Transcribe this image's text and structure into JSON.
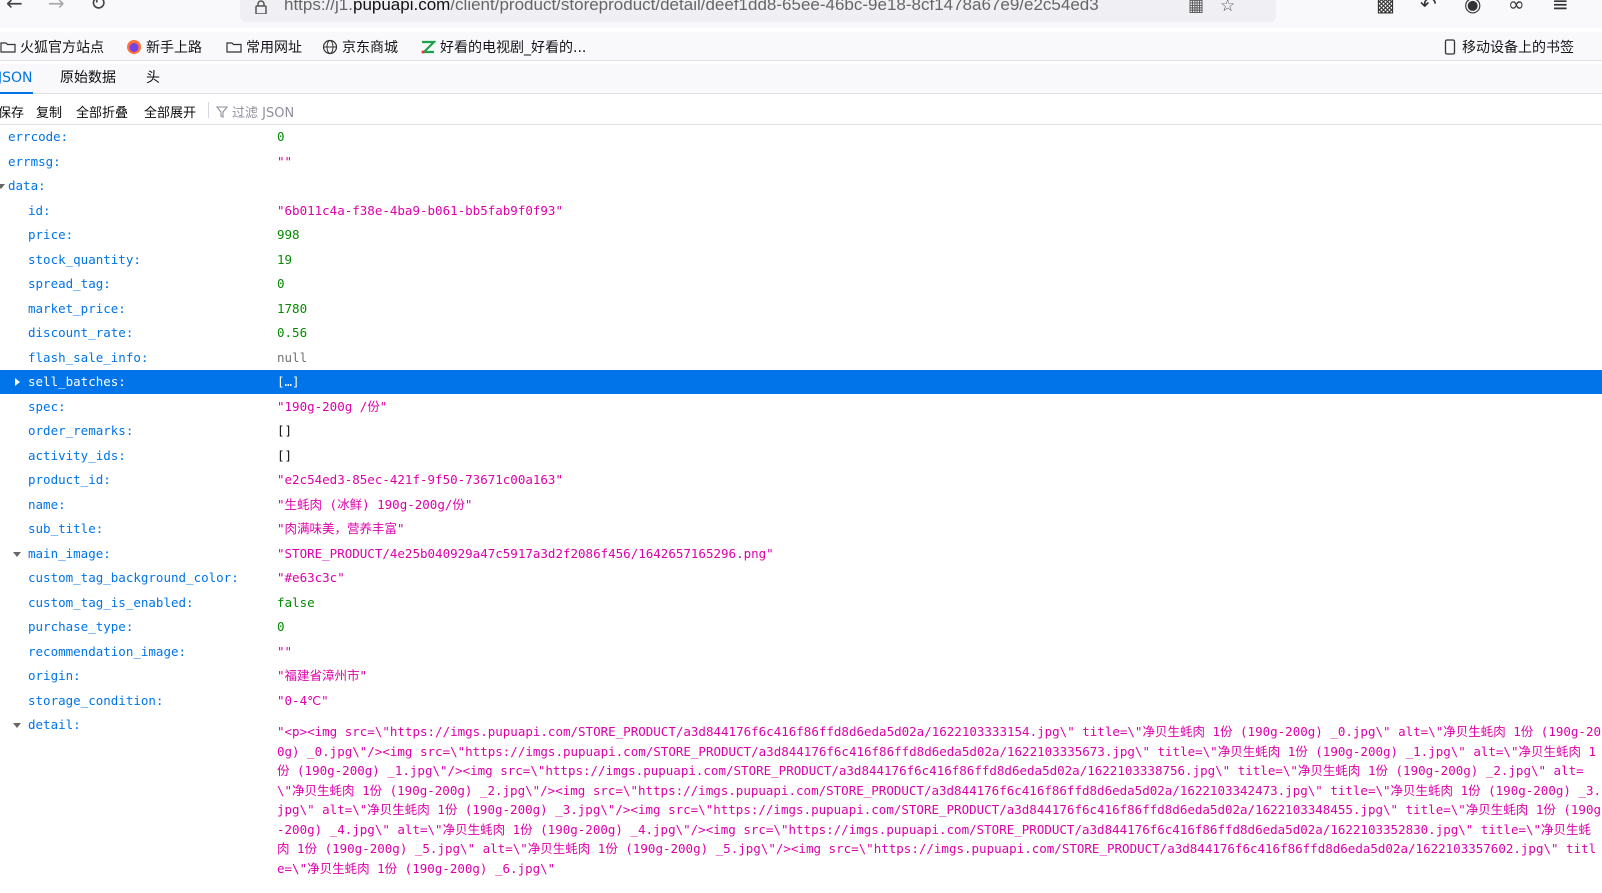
{
  "browser": {
    "url_prefix": "https://j1.",
    "url_host": "pupuapi.com",
    "url_path": "/client/product/storeproduct/detail/deef1dd8-65ee-46bc-9e18-8cf1478a67e9/e2c54ed3"
  },
  "bookmarks": [
    {
      "label": "火狐官方站点",
      "icon": "folder-icon"
    },
    {
      "label": "新手上路",
      "icon": "firefox-icon"
    },
    {
      "label": "常用网址",
      "icon": "folder-icon"
    },
    {
      "label": "京东商城",
      "icon": "globe-icon"
    },
    {
      "label": "好看的电视剧_好看的...",
      "icon": "site-icon"
    }
  ],
  "mobile_bookmarks": "移动设备上的书签",
  "tabs": [
    "JSON",
    "原始数据",
    "头"
  ],
  "toolbar": {
    "save": "保存",
    "copy": "复制",
    "collapse_all": "全部折叠",
    "expand_all": "全部展开",
    "filter_placeholder": "过滤 JSON"
  },
  "json": {
    "errcode": {
      "key": "errcode:",
      "value": "0"
    },
    "errmsg": {
      "key": "errmsg:",
      "value": "\"\""
    },
    "data_key": "data:",
    "id": {
      "key": "id:",
      "value": "\"6b011c4a-f38e-4ba9-b061-bb5fab9f0f93\""
    },
    "price": {
      "key": "price:",
      "value": "998"
    },
    "stock_quantity": {
      "key": "stock_quantity:",
      "value": "19"
    },
    "spread_tag": {
      "key": "spread_tag:",
      "value": "0"
    },
    "market_price": {
      "key": "market_price:",
      "value": "1780"
    },
    "discount_rate": {
      "key": "discount_rate:",
      "value": "0.56"
    },
    "flash_sale_info": {
      "key": "flash_sale_info:",
      "value": "null"
    },
    "sell_batches": {
      "key": "sell_batches:",
      "value": "[…]"
    },
    "spec": {
      "key": "spec:",
      "value": "\"190g-200g /份\""
    },
    "order_remarks": {
      "key": "order_remarks:",
      "value": "[]"
    },
    "activity_ids": {
      "key": "activity_ids:",
      "value": "[]"
    },
    "product_id": {
      "key": "product_id:",
      "value": "\"e2c54ed3-85ec-421f-9f50-73671c00a163\""
    },
    "name": {
      "key": "name:",
      "value": "\"生蚝肉 (冰鲜) 190g-200g/份\""
    },
    "sub_title": {
      "key": "sub_title:",
      "value": "\"肉满味美，营养丰富\""
    },
    "main_image": {
      "key": "main_image:",
      "value": "\"STORE_PRODUCT/4e25b040929a47c5917a3d2f2086f456/1642657165296.png\""
    },
    "custom_tag_background_color": {
      "key": "custom_tag_background_color:",
      "value": "\"#e63c3c\""
    },
    "custom_tag_is_enabled": {
      "key": "custom_tag_is_enabled:",
      "value": "false"
    },
    "purchase_type": {
      "key": "purchase_type:",
      "value": "0"
    },
    "recommendation_image": {
      "key": "recommendation_image:",
      "value": "\"\""
    },
    "origin": {
      "key": "origin:",
      "value": "\"福建省漳州市\""
    },
    "storage_condition": {
      "key": "storage_condition:",
      "value": "\"0-4℃\""
    },
    "detail_key": "detail:",
    "detail_value": "\"<p><img src=\\\"https://imgs.pupuapi.com/STORE_PRODUCT/a3d844176f6c416f86ffd8d6eda5d02a/1622103333154.jpg\\\" title=\\\"净贝生蚝肉 1份 (190g-200g) _0.jpg\\\" alt=\\\"净贝生蚝肉 1份 (190g-200g) _0.jpg\\\"/><img src=\\\"https://imgs.pupuapi.com/STORE_PRODUCT/a3d844176f6c416f86ffd8d6eda5d02a/1622103335673.jpg\\\" title=\\\"净贝生蚝肉 1份 (190g-200g) _1.jpg\\\" alt=\\\"净贝生蚝肉 1份 (190g-200g) _1.jpg\\\"/><img src=\\\"https://imgs.pupuapi.com/STORE_PRODUCT/a3d844176f6c416f86ffd8d6eda5d02a/1622103338756.jpg\\\" title=\\\"净贝生蚝肉 1份 (190g-200g) _2.jpg\\\" alt=\\\"净贝生蚝肉 1份 (190g-200g) _2.jpg\\\"/><img src=\\\"https://imgs.pupuapi.com/STORE_PRODUCT/a3d844176f6c416f86ffd8d6eda5d02a/1622103342473.jpg\\\" title=\\\"净贝生蚝肉 1份 (190g-200g) _3.jpg\\\" alt=\\\"净贝生蚝肉 1份 (190g-200g) _3.jpg\\\"/><img src=\\\"https://imgs.pupuapi.com/STORE_PRODUCT/a3d844176f6c416f86ffd8d6eda5d02a/1622103348455.jpg\\\" title=\\\"净贝生蚝肉 1份 (190g-200g) _4.jpg\\\" alt=\\\"净贝生蚝肉 1份 (190g-200g) _4.jpg\\\"/><img src=\\\"https://imgs.pupuapi.com/STORE_PRODUCT/a3d844176f6c416f86ffd8d6eda5d02a/1622103352830.jpg\\\" title=\\\"净贝生蚝肉 1份 (190g-200g) _5.jpg\\\" alt=\\\"净贝生蚝肉 1份 (190g-200g) _5.jpg\\\"/><img src=\\\"https://imgs.pupuapi.com/STORE_PRODUCT/a3d844176f6c416f86ffd8d6eda5d02a/1622103357602.jpg\\\" title=\\\"净贝生蚝肉 1份 (190g-200g) _6.jpg\\\""
  }
}
